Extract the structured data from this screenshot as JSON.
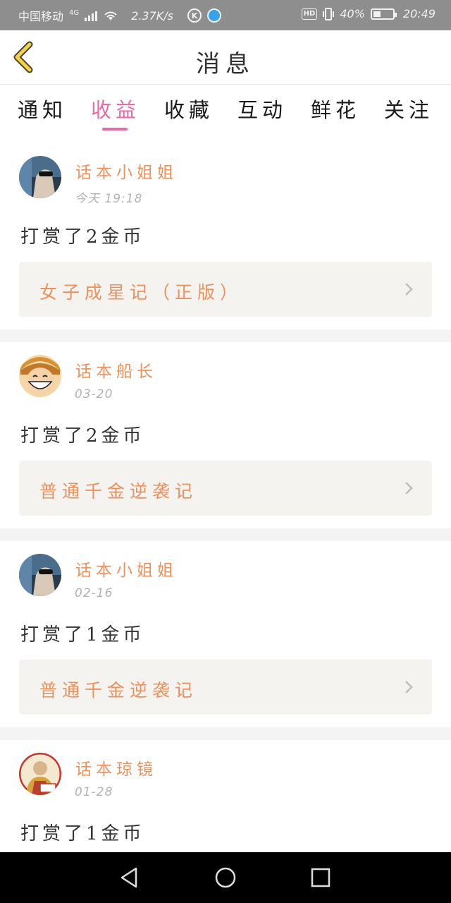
{
  "status_bar": {
    "carrier": "中国移动",
    "network": "4G",
    "speed": "2.37K/s",
    "k_badge": "K",
    "hd": "HD",
    "battery_pct": "40%",
    "battery_level": 0.4,
    "time": "20:49"
  },
  "header": {
    "title": "消息",
    "back_icon": "chevron-left-icon"
  },
  "tabs": [
    {
      "label": "通知"
    },
    {
      "label": "收益",
      "active": true
    },
    {
      "label": "收藏"
    },
    {
      "label": "互动"
    },
    {
      "label": "鲜花"
    },
    {
      "label": "关注"
    }
  ],
  "feed": [
    {
      "username": "话本小姐姐",
      "time": "今天 19:18",
      "message": "打赏了2金币",
      "link": "女子成星记（正版）",
      "avatar": "avatar-sunglasses"
    },
    {
      "username": "话本船长",
      "time": "03-20",
      "message": "打赏了2金币",
      "link": "普通千金逆袭记",
      "avatar": "avatar-luffy"
    },
    {
      "username": "话本小姐姐",
      "time": "02-16",
      "message": "打赏了1金币",
      "link": "普通千金逆袭记",
      "avatar": "avatar-sunglasses"
    },
    {
      "username": "话本琼镜",
      "time": "01-28",
      "message": "打赏了1金币",
      "link": "",
      "avatar": "avatar-monk"
    }
  ],
  "colors": {
    "accent_pink": "#e56aa5",
    "accent_orange": "#ec915e",
    "status_bar": "#8e8e8e",
    "nav_bar": "#000000"
  },
  "nav": {
    "back": "triangle-back-icon",
    "home": "circle-home-icon",
    "recent": "square-recent-icon"
  }
}
